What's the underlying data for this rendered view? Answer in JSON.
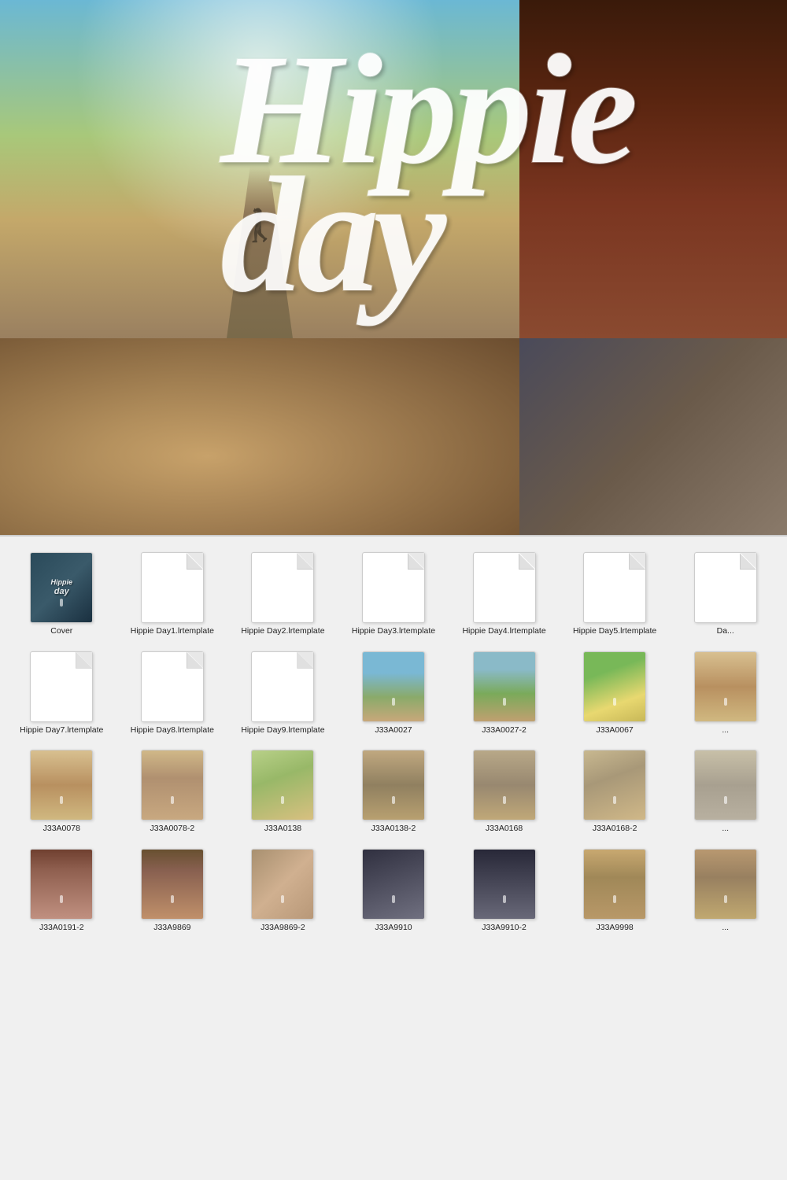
{
  "hero": {
    "title_word1": "Hippie",
    "title_word2": "day"
  },
  "files": {
    "items": [
      {
        "id": "cover",
        "type": "thumb",
        "thumb_class": "cover-thumb",
        "label": "Cover",
        "row": 1
      },
      {
        "id": "hippie-day1",
        "type": "doc",
        "label": "Hippie\nDay1.lrtemplate",
        "row": 1
      },
      {
        "id": "hippie-day2",
        "type": "doc",
        "label": "Hippie\nDay2.lrtemplate",
        "row": 1
      },
      {
        "id": "hippie-day3",
        "type": "doc",
        "label": "Hippie\nDay3.lrtemplate",
        "row": 1
      },
      {
        "id": "hippie-day4",
        "type": "doc",
        "label": "Hippie\nDay4.lrtemplate",
        "row": 1
      },
      {
        "id": "hippie-day5",
        "type": "doc",
        "label": "Hippie\nDay5.lrtemplate",
        "row": 1
      },
      {
        "id": "hippie-day6",
        "type": "doc",
        "label": "Da...",
        "row": 1
      },
      {
        "id": "hippie-day7",
        "type": "doc",
        "label": "Hippie\nDay7.lrtemplate",
        "row": 2
      },
      {
        "id": "hippie-day8",
        "type": "doc",
        "label": "Hippie\nDay8.lrtemplate",
        "row": 2
      },
      {
        "id": "hippie-day9",
        "type": "doc",
        "label": "Hippie\nDay9.lrtemplate",
        "row": 2
      },
      {
        "id": "j33a0027",
        "type": "thumb",
        "thumb_class": "thumb-road1",
        "label": "J33A0027",
        "row": 2
      },
      {
        "id": "j33a0027-2",
        "type": "thumb",
        "thumb_class": "thumb-road2",
        "label": "J33A0027-2",
        "row": 2
      },
      {
        "id": "j33a0067",
        "type": "thumb",
        "thumb_class": "thumb-field1",
        "label": "J33A0067",
        "row": 2
      },
      {
        "id": "j33a0067-2",
        "type": "thumb",
        "thumb_class": "thumb-girl1",
        "label": "...",
        "row": 2
      },
      {
        "id": "j33a0078",
        "type": "thumb",
        "thumb_class": "thumb-girl1",
        "label": "J33A0078",
        "row": 3
      },
      {
        "id": "j33a0078-2",
        "type": "thumb",
        "thumb_class": "thumb-girl2",
        "label": "J33A0078-2",
        "row": 3
      },
      {
        "id": "j33a0138",
        "type": "thumb",
        "thumb_class": "thumb-girl3",
        "label": "J33A0138",
        "row": 3
      },
      {
        "id": "j33a0138-2",
        "type": "thumb",
        "thumb_class": "thumb-girl4",
        "label": "J33A0138-2",
        "row": 3
      },
      {
        "id": "j33a0168",
        "type": "thumb",
        "thumb_class": "thumb-girl5",
        "label": "J33A0168",
        "row": 3
      },
      {
        "id": "j33a0168-2",
        "type": "thumb",
        "thumb_class": "thumb-girl6",
        "label": "J33A0168-2",
        "row": 3
      },
      {
        "id": "j33a0168-3",
        "type": "thumb",
        "thumb_class": "thumb-girl7",
        "label": "...",
        "row": 3
      },
      {
        "id": "j33a0191-2",
        "type": "thumb",
        "thumb_class": "thumb-girl8",
        "label": "J33A0191-2",
        "row": 4
      },
      {
        "id": "j33a9869",
        "type": "thumb",
        "thumb_class": "thumb-girl9",
        "label": "J33A9869",
        "row": 4
      },
      {
        "id": "j33a9869-2",
        "type": "thumb",
        "thumb_class": "thumb-hand",
        "label": "J33A9869-2",
        "row": 4
      },
      {
        "id": "j33a9910",
        "type": "thumb",
        "thumb_class": "thumb-dark1",
        "label": "J33A9910",
        "row": 4
      },
      {
        "id": "j33a9910-2",
        "type": "thumb",
        "thumb_class": "thumb-dark2",
        "label": "J33A9910-2",
        "row": 4
      },
      {
        "id": "j33a9998",
        "type": "thumb",
        "thumb_class": "thumb-girl10",
        "label": "J33A9998",
        "row": 4
      },
      {
        "id": "j33a9999",
        "type": "thumb",
        "thumb_class": "thumb-girl11",
        "label": "...",
        "row": 4
      }
    ]
  }
}
